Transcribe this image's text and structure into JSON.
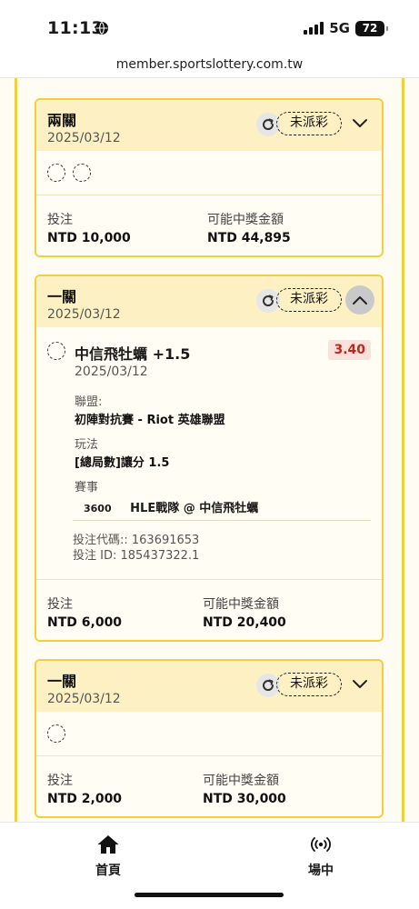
{
  "status_bar": {
    "time": "11:13",
    "network": "5G",
    "battery": "72"
  },
  "url": "member.sportslottery.com.tw",
  "bets": [
    {
      "title": "兩關",
      "date": "2025/03/12",
      "status": "未派彩",
      "stake_label": "投注",
      "stake_value": "NTD 10,000",
      "win_label": "可能中獎金額",
      "win_value": "NTD 44,895"
    },
    {
      "title": "一關",
      "date": "2025/03/12",
      "status": "未派彩",
      "selection": {
        "name": "中信飛牡蠣 +1.5",
        "date": "2025/03/12",
        "odds": "3.40",
        "league_label": "聯盟:",
        "league_value": "初陣對抗賽 - Riot 英雄聯盟",
        "play_label": "玩法",
        "play_value": "[總局數]讓分 1.5",
        "event_label": "賽事",
        "match_id": "3600",
        "match_name": "HLE戰隊 @ 中信飛牡蠣",
        "code_line": "投注代碼:: 163691653",
        "id_line": "投注 ID: 185437322.1"
      },
      "stake_label": "投注",
      "stake_value": "NTD 6,000",
      "win_label": "可能中獎金額",
      "win_value": "NTD 20,400"
    },
    {
      "title": "一關",
      "date": "2025/03/12",
      "status": "未派彩",
      "stake_label": "投注",
      "stake_value": "NTD 2,000",
      "win_label": "可能中獎金額",
      "win_value": "NTD 30,000"
    }
  ],
  "nav": {
    "home": "首頁",
    "live": "場中"
  },
  "colors": {
    "accent": "#f3cf3c",
    "header_bg": "#fdf1c4",
    "odds": "#c0261c"
  }
}
